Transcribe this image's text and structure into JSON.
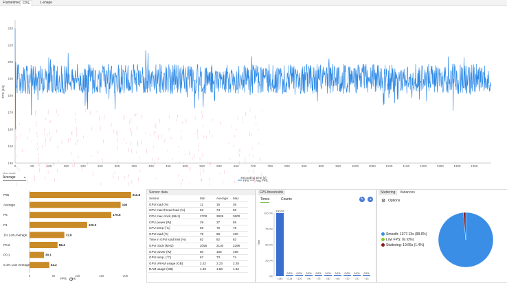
{
  "tabs": [
    {
      "label": "Frametimes"
    },
    {
      "label": "FPS"
    },
    {
      "label": "L-shape"
    }
  ],
  "main_chart": {
    "ylabel": "FPS [1/s]",
    "xlabel": "Recording time [s]",
    "legend": [
      "FPS",
      "Avg FPS"
    ],
    "yticks": [
      "140",
      "150",
      "160",
      "170",
      "180",
      "190",
      "200",
      "210",
      "220"
    ],
    "xticks": [
      "0",
      "50",
      "100",
      "150",
      "200",
      "250",
      "300",
      "350",
      "400",
      "450",
      "500",
      "550",
      "600",
      "650",
      "700",
      "750",
      "800",
      "850",
      "900",
      "950",
      "1000",
      "1050",
      "1100",
      "1150",
      "1200",
      "1250",
      "1300",
      "1350"
    ]
  },
  "line_mode": {
    "label": "Line mode",
    "value": "Average"
  },
  "stats": {
    "rows": [
      {
        "label": "P95",
        "value": "211.8"
      },
      {
        "label": "Average",
        "value": "190"
      },
      {
        "label": "P5",
        "value": "170.6"
      },
      {
        "label": "P1",
        "value": "120.2"
      },
      {
        "label": "1% Low Average",
        "value": "72.6"
      },
      {
        "label": "P0.2",
        "value": "58.4"
      },
      {
        "label": "P0.1",
        "value": "30.1"
      },
      {
        "label": "0.1% Low Average",
        "value": "41.2"
      }
    ],
    "xticks": [
      "0",
      "50",
      "100",
      "150",
      "200"
    ],
    "unit_fps": "FPS",
    "unit_ms": "ms"
  },
  "sensor": {
    "title": "Sensor data",
    "headers": [
      "Sensor",
      "Min",
      "Average",
      "Max"
    ],
    "rows": [
      [
        "GPU load (%)",
        "11",
        "15",
        "35"
      ],
      [
        "CPU max thread load (%)",
        "63",
        "74",
        "93"
      ],
      [
        "CPU max clock (MHz)",
        "2700",
        "2926",
        "3600"
      ],
      [
        "CPU power (W)",
        "29",
        "37",
        "55"
      ],
      [
        "CPU temp (°C)",
        "59",
        "76",
        "78"
      ],
      [
        "GPU load (%)",
        "76",
        "98",
        "100"
      ],
      [
        "Time in GPU load limit (%)",
        "82",
        "82",
        "82"
      ],
      [
        "GPU clock (MHz)",
        "2055",
        "2130",
        "2295"
      ],
      [
        "GPU power (W)",
        "50",
        "166",
        "196"
      ],
      [
        "GPU temp. (°C)",
        "67",
        "73",
        "74"
      ],
      [
        "GPU VRAM usage (GB)",
        "2.22",
        "2.23",
        "2.28"
      ],
      [
        "RAM usage (GB)",
        "1.49",
        "1.58",
        "1.62"
      ]
    ]
  },
  "thresholds": {
    "tab": "FPS thresholds",
    "subtabs": [
      "Times",
      "Counts"
    ],
    "ylabel": "Time",
    "bars": [
      {
        "top": "100.0%",
        "bottom": "<240"
      },
      {
        "top": "0.0%",
        "bottom": "<144"
      },
      {
        "top": "0.0%",
        "bottom": "<120"
      },
      {
        "top": "0.0%",
        "bottom": "<90"
      },
      {
        "top": "0.0%",
        "bottom": "<75"
      },
      {
        "top": "0.0%",
        "bottom": "<60"
      },
      {
        "top": "0.0%",
        "bottom": "<45"
      },
      {
        "top": "0.0%",
        "bottom": "<30"
      },
      {
        "top": "0.0%",
        "bottom": "<20"
      },
      {
        "top": "0.0%",
        "bottom": "<15"
      }
    ],
    "yticks": [
      "0%",
      "25.0%",
      "50.0%",
      "75.0%",
      "100.0%"
    ]
  },
  "stuttering": {
    "tabs": [
      "Stuttering",
      "Variances"
    ],
    "options_label": "Options",
    "legend": [
      {
        "label": "Smooth: 1377.13s (98.6%)",
        "color": "#3a8ee6"
      },
      {
        "label": "Low FPS: 0s (0%)",
        "color": "#8ac926"
      },
      {
        "label": "Stuttering: 19.65s (1.4%)",
        "color": "#8b1a1a"
      }
    ],
    "pie": [
      98.6,
      0,
      1.4
    ]
  },
  "colors": {
    "fps": "#2f8ae6",
    "bar": "#c98a28",
    "ghost": "#f6c3d6"
  }
}
